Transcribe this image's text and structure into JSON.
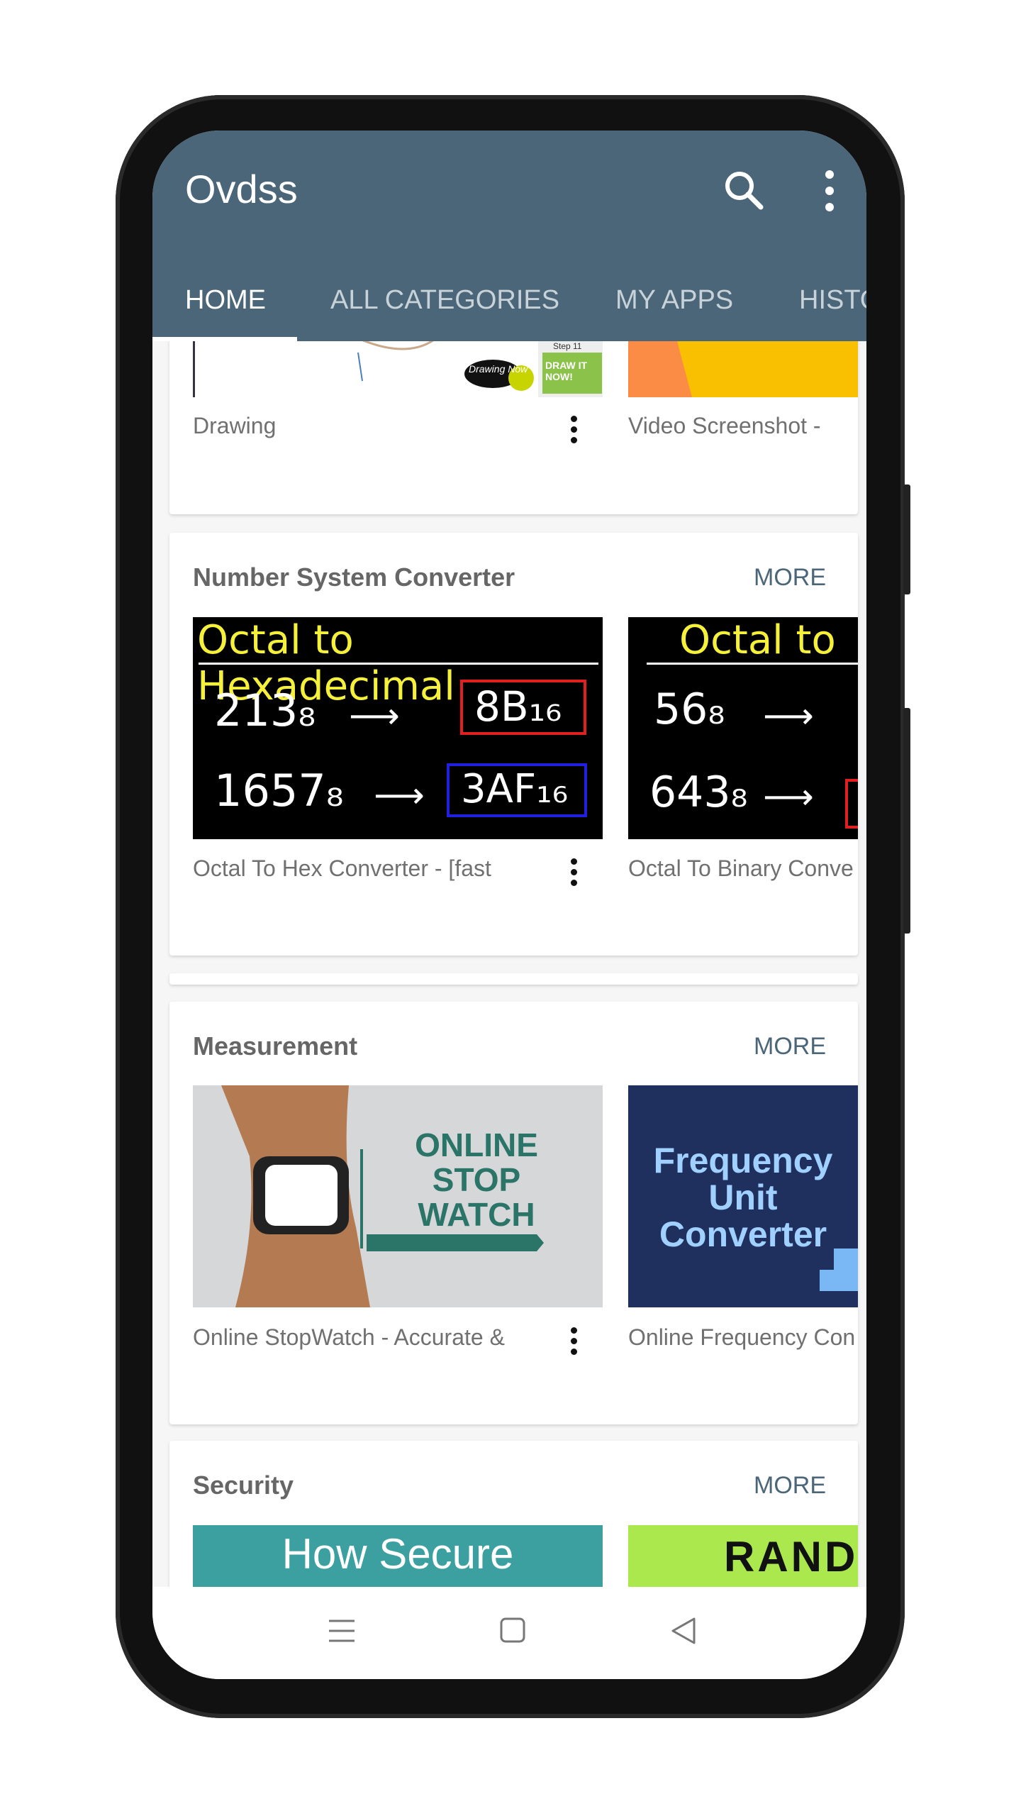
{
  "app": {
    "title": "Ovdss",
    "accent": "#4c6679"
  },
  "toolbar": {
    "search_icon": "search-icon",
    "menu_icon": "more-vert-icon"
  },
  "tabs": [
    {
      "label": "HOME",
      "active": true
    },
    {
      "label": "ALL CATEGORIES"
    },
    {
      "label": "MY APPS"
    },
    {
      "label": "HISTO"
    }
  ],
  "sections": [
    {
      "title": "",
      "items": [
        {
          "caption": "Drawing",
          "thumb_text": [
            "Drawing Now",
            "DRAW IT NOW!",
            "Step 11"
          ]
        },
        {
          "caption": "Video Screenshot -"
        }
      ]
    },
    {
      "title": "Number System Converter",
      "more": "MORE",
      "items": [
        {
          "caption": "Octal To Hex Converter - [fast",
          "thumb_text": [
            "Octal to Hexadecimal",
            "213₈",
            "8B₁₆",
            "1657₈",
            "3AF₁₆"
          ]
        },
        {
          "caption": "Octal To Binary Conve",
          "thumb_text": [
            "Octal to",
            "56₈",
            "643₈"
          ]
        }
      ]
    },
    {
      "title": "Measurement",
      "more": "MORE",
      "items": [
        {
          "caption": "Online StopWatch - Accurate &",
          "thumb_text": [
            "ONLINE",
            "STOP",
            "WATCH"
          ]
        },
        {
          "caption": "Online Frequency Con",
          "thumb_text": [
            "Frequency",
            "Unit",
            "Converter"
          ]
        }
      ]
    },
    {
      "title": "Security",
      "more": "MORE",
      "items": [
        {
          "caption": "",
          "thumb_text": [
            "How Secure"
          ]
        },
        {
          "caption": "",
          "thumb_text": [
            "RAND"
          ]
        }
      ]
    }
  ],
  "navbar": {
    "menu": "menu-icon",
    "home": "home-square-icon",
    "back": "back-triangle-icon"
  }
}
